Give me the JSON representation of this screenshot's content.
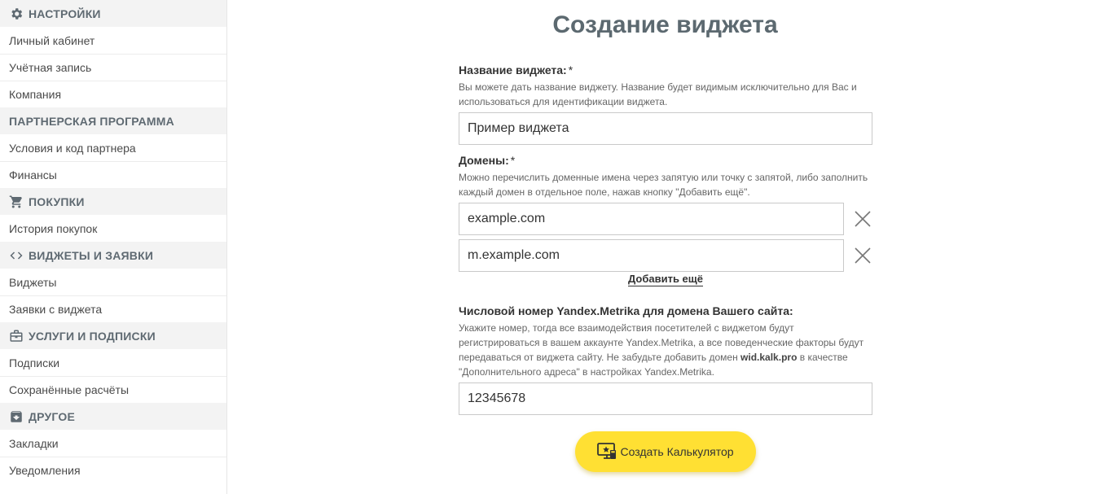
{
  "sidebar": {
    "sections": [
      {
        "title": "НАСТРОЙКИ",
        "icon": "gear-icon",
        "items": [
          "Личный кабинет",
          "Учётная запись",
          "Компания"
        ]
      },
      {
        "title": "ПАРТНЕРСКАЯ ПРОГРАММА",
        "icon": "",
        "items": [
          "Условия и код партнера",
          "Финансы"
        ]
      },
      {
        "title": "ПОКУПКИ",
        "icon": "cart-icon",
        "items": [
          "История покупок"
        ]
      },
      {
        "title": "ВИДЖЕТЫ И ЗАЯВКИ",
        "icon": "code-icon",
        "items": [
          "Виджеты",
          "Заявки с виджета"
        ]
      },
      {
        "title": "УСЛУГИ И ПОДПИСКИ",
        "icon": "briefcase-icon",
        "items": [
          "Подписки",
          "Сохранённые расчёты"
        ]
      },
      {
        "title": "ДРУГОЕ",
        "icon": "archive-icon",
        "items": [
          "Закладки",
          "Уведомления"
        ]
      }
    ]
  },
  "main": {
    "title": "Создание виджета",
    "widget_name": {
      "label": "Название виджета:",
      "required": "*",
      "hint": "Вы можете дать название виджету. Название будет видимым исключительно для Вас и использоваться для идентификации виджета.",
      "value": "Пример виджета"
    },
    "domains": {
      "label": "Домены:",
      "required": "*",
      "hint": "Можно перечислить доменные имена через запятую или точку с запятой, либо заполнить каждый домен в отдельное поле, нажав кнопку \"Добавить ещё\".",
      "values": [
        "example.com",
        "m.example.com"
      ],
      "add_more": "Добавить ещё"
    },
    "metrika": {
      "label": "Числовой номер Yandex.Metrika для домена Вашего сайта:",
      "hint_before": "Укажите номер, тогда все взаимодействия посетителей с виджетом будут регистрироваться в вашем аккаунте Yandex.Metrika, а все поведенческие факторы будут передаваться от виджета сайту. Не забудьте добавить домен ",
      "hint_domain": "wid.kalk.pro",
      "hint_after": " в качестве \"Дополнительного адреса\" в настройках Yandex.Metrika.",
      "value": "12345678"
    },
    "create_button": "Создать Калькулятор"
  },
  "colors": {
    "accent": "#ffe033",
    "title": "#5c6970",
    "section_bg": "#f3f3f3"
  }
}
